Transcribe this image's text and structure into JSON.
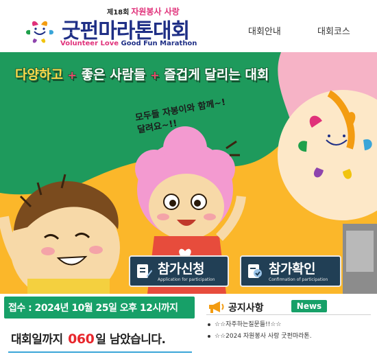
{
  "header": {
    "logo_edition": "제18회",
    "logo_sub": "자원봉사 사랑",
    "logo_title": "굿펀마라톤대회",
    "logo_eng": {
      "part1": "Volunteer Love",
      "part2": "Good Fun Marathon"
    },
    "nav": [
      {
        "label": "대회안내"
      },
      {
        "label": "대회코스"
      }
    ]
  },
  "banner": {
    "slogan": {
      "part1": "다양하고",
      "part2": "좋은 사람들",
      "part3": "즐겁게 달리는 대회",
      "plus": "+"
    },
    "speech_line1": "모두들 자봉이와 함께~!",
    "speech_line2": "달려요~!!",
    "buttons": {
      "apply": {
        "label": "참가신청",
        "sub": "Application for participation"
      },
      "check": {
        "label": "참가확인",
        "sub": "Confirmation of participation"
      }
    }
  },
  "registration": {
    "deadline": "접수 : 2024년 10월 25일 오후 12시까지"
  },
  "countdown": {
    "prefix": "대회일까지",
    "days": "060",
    "suffix": "일 남았습니다."
  },
  "notice": {
    "title": "공지사항",
    "badge": "News",
    "items": [
      {
        "text": "☆☆자주하는질문들!!☆☆"
      },
      {
        "text": "☆☆2024 자원봉사 사랑 굿펀마라톤."
      }
    ]
  },
  "colors": {
    "navy": "#1f2f86",
    "pink": "#e0317a",
    "green": "#17a068",
    "yellow": "#fbb72a",
    "button_bg": "#213f55"
  }
}
